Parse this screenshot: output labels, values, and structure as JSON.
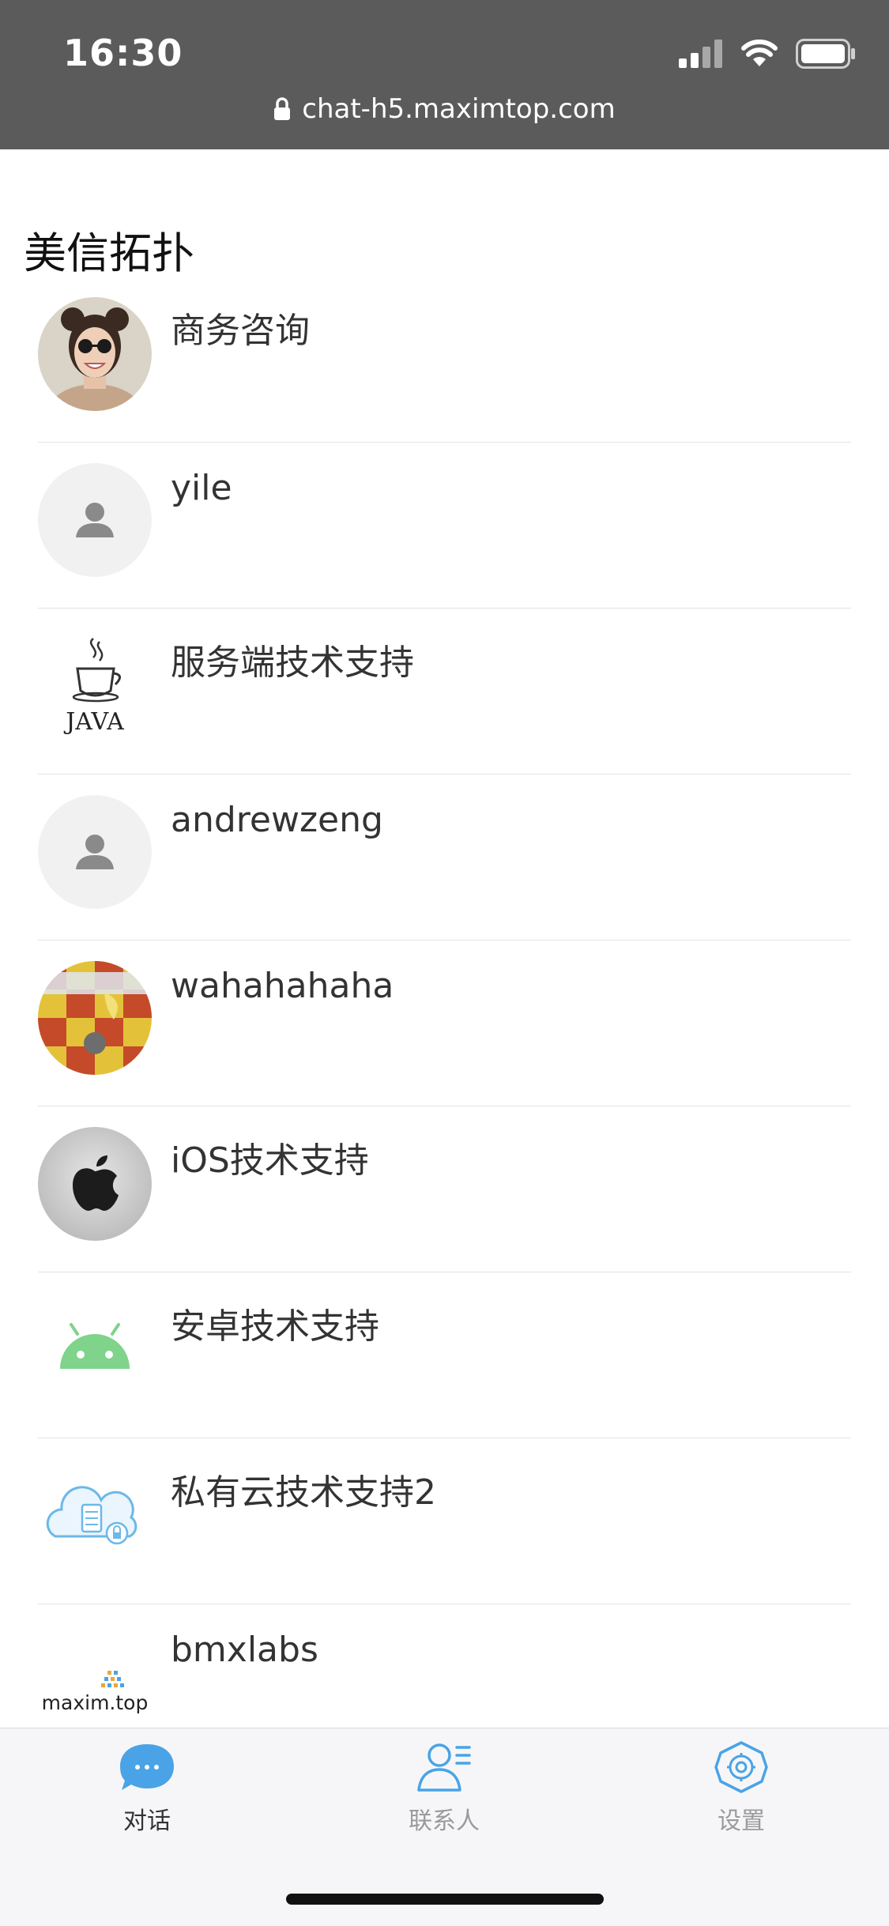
{
  "status_bar": {
    "time": "16:30",
    "url": "chat-h5.maximtop.com",
    "icons": [
      "signal-icon",
      "wifi-icon",
      "battery-icon",
      "lock-icon"
    ]
  },
  "app": {
    "title": "美信拓扑"
  },
  "contacts": [
    {
      "name": "商务咨询",
      "avatar": "photo-avatar"
    },
    {
      "name": "yile",
      "avatar": "default-person-avatar"
    },
    {
      "name": "服务端技术支持",
      "avatar": "java-logo-avatar"
    },
    {
      "name": "andrewzeng",
      "avatar": "default-person-avatar"
    },
    {
      "name": "wahahahaha",
      "avatar": "photo-avatar"
    },
    {
      "name": "iOS技术支持",
      "avatar": "apple-logo-avatar"
    },
    {
      "name": "安卓技术支持",
      "avatar": "android-logo-avatar"
    },
    {
      "name": "私有云技术支持2",
      "avatar": "cloud-logo-avatar"
    },
    {
      "name": "bmxlabs",
      "avatar": "maxim-logo-avatar",
      "logo_text": "maxim.top"
    }
  ],
  "java_logo_text": "JAVA",
  "tabs": [
    {
      "label": "对话",
      "icon": "chat-bubble-icon",
      "active": true
    },
    {
      "label": "联系人",
      "icon": "contacts-icon",
      "active": false
    },
    {
      "label": "设置",
      "icon": "settings-gear-icon",
      "active": false
    }
  ],
  "colors": {
    "status_bar_bg": "#5b5b5b",
    "accent": "#4aa3e6",
    "tab_inactive": "#9a9a9a",
    "tab_active_label": "#333333",
    "android_green": "#7fd38a"
  }
}
